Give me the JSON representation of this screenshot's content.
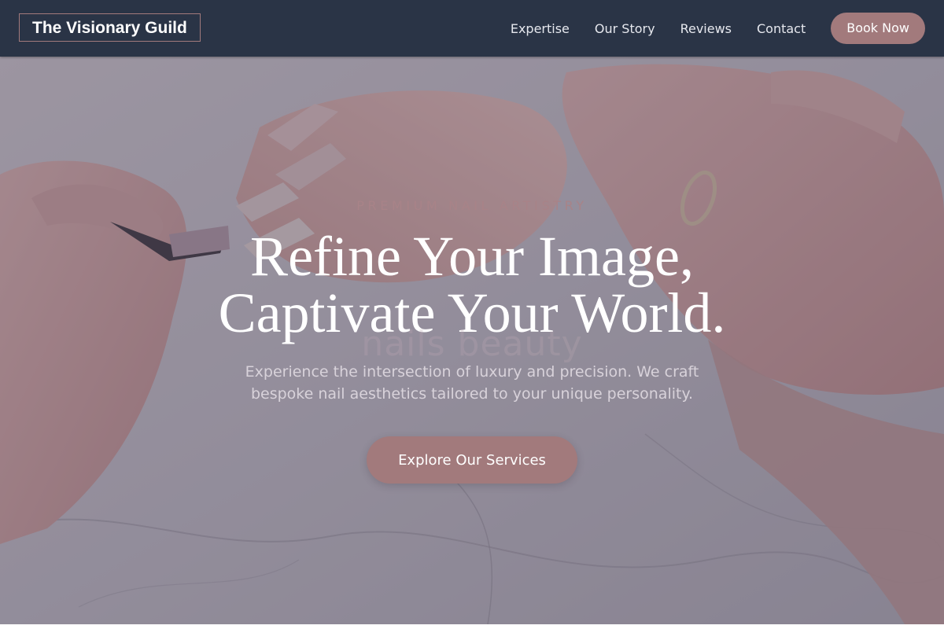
{
  "header": {
    "logo_text": "The Visionary Guild",
    "nav": [
      {
        "label": "Expertise"
      },
      {
        "label": "Our Story"
      },
      {
        "label": "Reviews"
      },
      {
        "label": "Contact"
      }
    ],
    "book_label": "Book Now"
  },
  "hero": {
    "eyebrow": "PREMIUM NAIL ARTISTRY",
    "headline_line1": "Refine Your Image,",
    "headline_line2": "Captivate Your World.",
    "watermark": "nails beauty",
    "subtitle": "Experience the intersection of luxury and precision. We craft bespoke nail aesthetics tailored to your unique personality.",
    "cta_label": "Explore Our Services",
    "image_description": "hands-manicure-photo"
  },
  "colors": {
    "nav_bg": "#2a3446",
    "accent": "#a27a7c",
    "eyebrow": "#a88388",
    "headline": "#ffffff",
    "subtitle": "#d8d2da"
  }
}
